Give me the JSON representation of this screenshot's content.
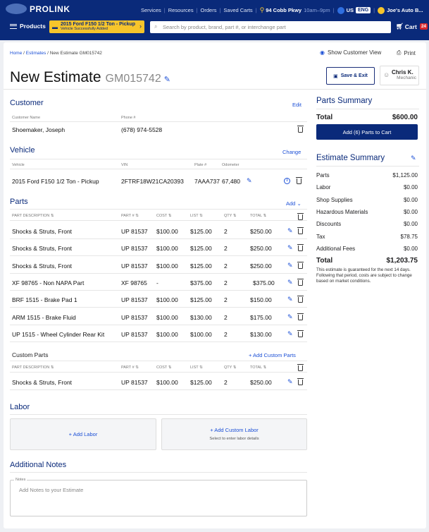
{
  "header": {
    "logo": "PROLINK",
    "nav": [
      "Services",
      "Resources",
      "Orders",
      "Saved Carts"
    ],
    "store_address": "94 Cobb Pkwy",
    "store_hours": "10am–9pm",
    "country": "US",
    "language": "ENG",
    "account": "Joe's Auto B...",
    "products_label": "Products",
    "vehicle_title": "2015 Ford F150 1/2 Ton - Pickup",
    "vehicle_sub": "Vehicle Successfully Added",
    "search_placeholder": "Search by product, brand, part #, or interchange part",
    "cart_label": "Cart",
    "cart_count": "24"
  },
  "page": {
    "breadcrumb": [
      "Home",
      "Estimates",
      "New Estimate"
    ],
    "breadcrumb_id": "GM015742",
    "title": "New Estimate",
    "estimate_number": "GM015742",
    "show_customer_view": "Show Customer View",
    "print": "Print",
    "save_exit": "Save & Exit",
    "user_name": "Chris K.",
    "user_role": "Mechanic"
  },
  "customer": {
    "title": "Customer",
    "edit": "Edit",
    "name_label": "Customer Name",
    "phone_label": "Phone #",
    "name": "Shoemaker, Joseph",
    "phone": "(678) 974-5528"
  },
  "vehicle": {
    "title": "Vehicle",
    "change": "Change",
    "headers": [
      "Vehicle",
      "VIN",
      "Plate #",
      "Odometer"
    ],
    "name": "2015 Ford F150 1/2 Ton - Pickup",
    "vin": "2FTRF18W21CA20393",
    "plate": "7AAA737",
    "odometer": "67,480"
  },
  "parts": {
    "title": "Parts",
    "add": "Add",
    "headers": [
      "PART DESCRIPTION ⇅",
      "PART # ⇅",
      "COST ⇅",
      "LIST ⇅",
      "QTY ⇅",
      "TOTAL ⇅"
    ],
    "rows": [
      {
        "desc": "Shocks & Struts, Front",
        "part": "UP 81537",
        "cost": "$100.00",
        "list": "$125.00",
        "qty": "2",
        "total": "$250.00"
      },
      {
        "desc": "Shocks & Struts, Front",
        "part": "UP 81537",
        "cost": "$100.00",
        "list": "$125.00",
        "qty": "2",
        "total": "$250.00"
      },
      {
        "desc": "Shocks & Struts, Front",
        "part": "UP 81537",
        "cost": "$100.00",
        "list": "$125.00",
        "qty": "2",
        "total": "$250.00"
      },
      {
        "desc": "XF 98765 - Non NAPA Part",
        "part": "XF 98765",
        "cost": "-",
        "list": "$375.00",
        "qty": "2",
        "total": "$375.00"
      },
      {
        "desc": "BRF 1515 - Brake Pad 1",
        "part": "UP 81537",
        "cost": "$100.00",
        "list": "$125.00",
        "qty": "2",
        "total": "$150.00"
      },
      {
        "desc": "ARM 1515 - Brake Fluid",
        "part": "UP 81537",
        "cost": "$100.00",
        "list": "$130.00",
        "qty": "2",
        "total": "$175.00"
      },
      {
        "desc": "UP 1515 - Wheel Cylinder Rear Kit",
        "part": "UP 81537",
        "cost": "$100.00",
        "list": "$100.00",
        "qty": "2",
        "total": "$130.00"
      }
    ]
  },
  "custom_parts": {
    "title": "Custom Parts",
    "add": "+ Add Custom Parts",
    "headers": [
      "PART DESCRIPTION ⇅",
      "PART # ⇅",
      "COST ⇅",
      "LIST ⇅",
      "QTY ⇅",
      "TOTAL ⇅"
    ],
    "rows": [
      {
        "desc": "Shocks & Struts, Front",
        "part": "UP 81537",
        "cost": "$100.00",
        "list": "$125.00",
        "qty": "2",
        "total": "$250.00"
      }
    ]
  },
  "labor": {
    "title": "Labor",
    "add": "+ Add Labor",
    "add_custom": "+ Add Custom Labor",
    "custom_sub": "Select to enter labor details"
  },
  "notes": {
    "title": "Additional Notes",
    "label": "Notes",
    "placeholder": "Add Notes to your Estimate"
  },
  "parts_summary": {
    "title": "Parts Summary",
    "total_label": "Total",
    "total": "$600.00",
    "add_to_cart": "Add (6) Parts to Cart"
  },
  "estimate_summary": {
    "title": "Estimate Summary",
    "rows": [
      {
        "label": "Parts",
        "value": "$1,125.00"
      },
      {
        "label": "Labor",
        "value": "$0.00"
      },
      {
        "label": "Shop Supplies",
        "value": "$0.00"
      },
      {
        "label": "Hazardous Materials",
        "value": "$0.00"
      },
      {
        "label": "Discounts",
        "value": "$0.00"
      },
      {
        "label": "Tax",
        "value": "$78.75"
      },
      {
        "label": "Additional Fees",
        "value": "$0.00"
      }
    ],
    "total_label": "Total",
    "total": "$1,203.75",
    "disclaimer": "This estimate is guaranteed for the next 14 days. Following that period, costs are subject to change based on market conditions."
  },
  "colors": {
    "brand_navy": "#0a2a7a",
    "accent_yellow": "#f7c52b",
    "link_blue": "#1b4fd6",
    "cart_badge_red": "#d9262b"
  }
}
